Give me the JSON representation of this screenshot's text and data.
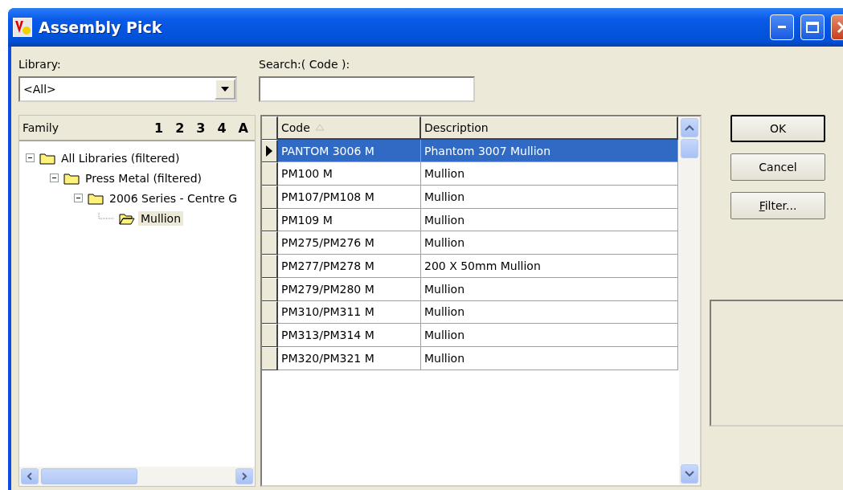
{
  "window": {
    "title": "Assembly Pick"
  },
  "library": {
    "label": "Library:",
    "value": "<All>"
  },
  "search": {
    "label": "Search:( Code ):"
  },
  "tree": {
    "header": "Family",
    "level_buttons": [
      "1",
      "2",
      "3",
      "4",
      "A"
    ],
    "items": [
      {
        "label": "All Libraries (filtered)",
        "expanded": true,
        "selected": false,
        "children": [
          {
            "label": "Press Metal (filtered)",
            "expanded": true,
            "selected": false,
            "children": [
              {
                "label": "2006 Series - Centre G",
                "expanded": true,
                "selected": false,
                "children": [
                  {
                    "label": "Mullion",
                    "selected": true
                  }
                ]
              }
            ]
          }
        ]
      }
    ]
  },
  "grid": {
    "columns": [
      {
        "label": "Code",
        "sorted": true
      },
      {
        "label": "Description",
        "sorted": false
      }
    ],
    "rows": [
      {
        "code": "PANTOM 3006 M",
        "description": "Phantom 3007 Mullion",
        "selected": true
      },
      {
        "code": "PM100 M",
        "description": "Mullion",
        "selected": false
      },
      {
        "code": "PM107/PM108 M",
        "description": "Mullion",
        "selected": false
      },
      {
        "code": "PM109 M",
        "description": "Mullion",
        "selected": false
      },
      {
        "code": "PM275/PM276 M",
        "description": "Mullion",
        "selected": false
      },
      {
        "code": "PM277/PM278 M",
        "description": "200 X 50mm Mullion",
        "selected": false
      },
      {
        "code": "PM279/PM280 M",
        "description": "Mullion",
        "selected": false
      },
      {
        "code": "PM310/PM311 M",
        "description": "Mullion",
        "selected": false
      },
      {
        "code": "PM313/PM314 M",
        "description": "Mullion",
        "selected": false
      },
      {
        "code": "PM320/PM321 M",
        "description": "Mullion",
        "selected": false
      }
    ]
  },
  "buttons": [
    {
      "label": "OK",
      "default": true,
      "access_key_underlined": false
    },
    {
      "label": "Cancel",
      "default": false,
      "access_key_underlined": false
    },
    {
      "label": "Filter...",
      "default": false,
      "access_key_underlined": true
    }
  ]
}
